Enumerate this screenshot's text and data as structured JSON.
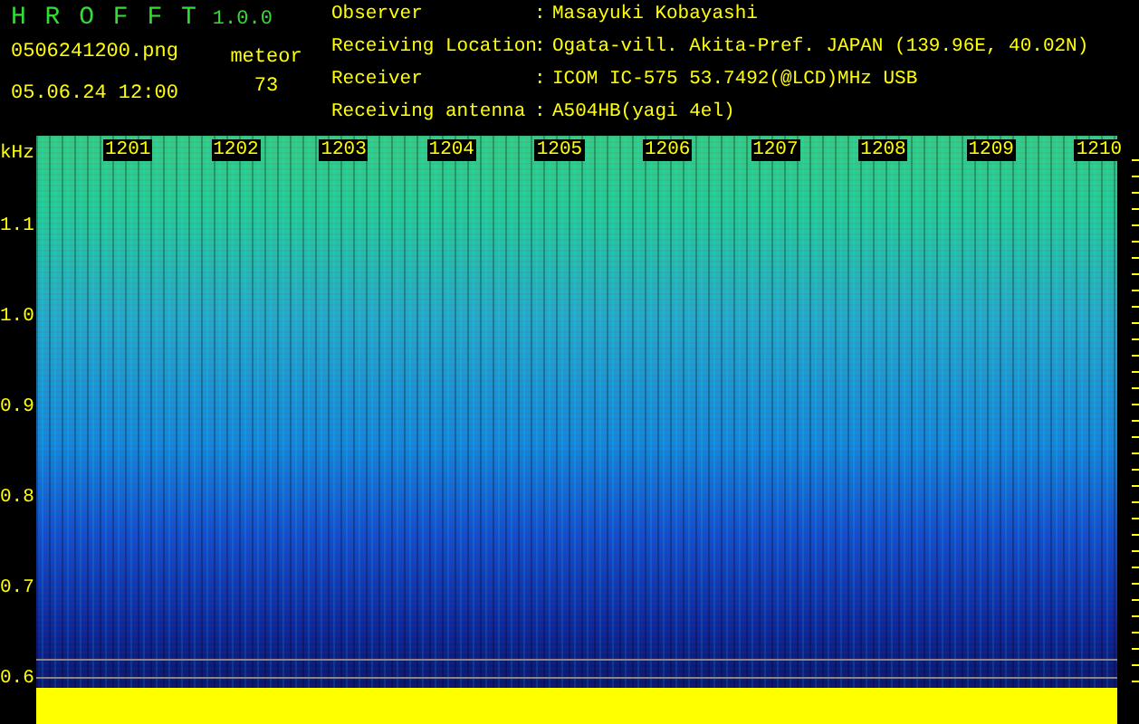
{
  "header": {
    "app_name": "H R O F F T",
    "version": "1.0.0",
    "filename": "0506241200.png",
    "datetime": "05.06.24 12:00",
    "meteor_label": "meteor",
    "meteor_count": "73"
  },
  "station": [
    {
      "label": "Observer",
      "separator": ":",
      "value": "Masayuki Kobayashi"
    },
    {
      "label": "Receiving Location",
      "separator": ":",
      "value": "Ogata-vill. Akita-Pref. JAPAN (139.96E, 40.02N)"
    },
    {
      "label": "Receiver",
      "separator": ":",
      "value": "ICOM IC-575 53.7492(@LCD)MHz USB"
    },
    {
      "label": "Receiving antenna",
      "separator": ":",
      "value": "A504HB(yagi 4el)"
    }
  ],
  "spectrogram": {
    "y_unit": "kHz",
    "x_labels": [
      "1201",
      "1202",
      "1203",
      "1204",
      "1205",
      "1206",
      "1207",
      "1208",
      "1209",
      "1210"
    ],
    "y_labels": [
      "1.1",
      "1.0",
      "0.9",
      "0.8",
      "0.7",
      "0.6"
    ]
  }
}
